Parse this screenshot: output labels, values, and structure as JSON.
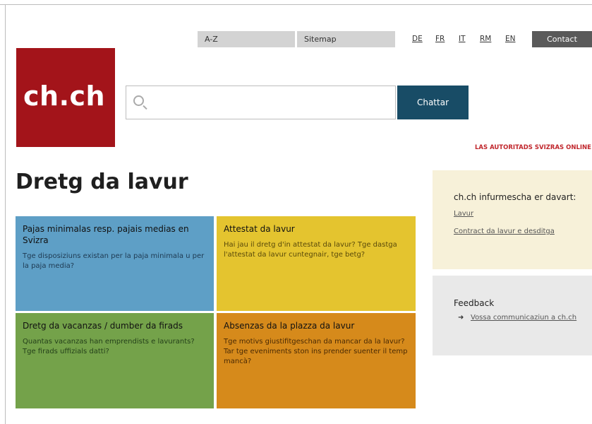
{
  "nav": {
    "az": "A-Z",
    "sitemap": "Sitemap",
    "languages": [
      "DE",
      "FR",
      "IT",
      "RM",
      "EN"
    ],
    "contact": "Contact"
  },
  "logo": {
    "text": "ch.ch"
  },
  "search": {
    "value": "",
    "placeholder": "",
    "button": "Chattar"
  },
  "tagline": "LAS AUTORITADS SVIZRAS ONLINE",
  "page_title": "Dretg da lavur",
  "tiles": [
    {
      "title": "Pajas minimalas resp. pajais medias en Svizra",
      "text": "Tge disposiziuns existan per la paja minimala u per la paja media?",
      "color": "#5e9fc6"
    },
    {
      "title": "Attestat da lavur",
      "text": "Hai jau il dretg d'in attestat da lavur? Tge dastga l'attestat da lavur cuntegnair, tge betg?",
      "color": "#e4c42f"
    },
    {
      "title": "Dretg da vacanzas / dumber da firads",
      "text": "Quantas vacanzas han emprendists e lavurants? Tge firads uffizials datti?",
      "color": "#74a24a"
    },
    {
      "title": "Absenzas da la plazza da lavur",
      "text": "Tge motivs giustifitgeschan da mancar da la lavur? Tar tge eveniments ston ins prender suenter il temp mancà?",
      "color": "#d68a1b"
    }
  ],
  "info": {
    "heading": "ch.ch infurmescha er davart:",
    "links": [
      "Lavur",
      "Contract da lavur e desditga"
    ]
  },
  "feedback": {
    "heading": "Feedback",
    "link": "Vossa communicaziun a ch.ch"
  },
  "colors": {
    "brand": "#a3141a",
    "button": "#184c66",
    "tagline": "#c0262c"
  }
}
